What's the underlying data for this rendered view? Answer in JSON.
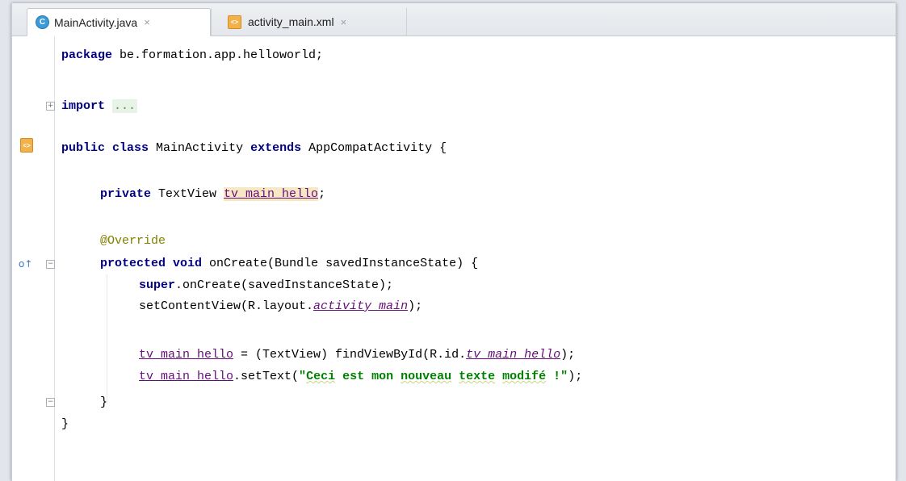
{
  "tabs": [
    {
      "label": "MainActivity.java",
      "icon": "java-class-icon",
      "active": true,
      "close": "×"
    },
    {
      "label": "activity_main.xml",
      "icon": "xml-layout-icon",
      "active": false,
      "close": "×"
    }
  ],
  "code": {
    "package_kw": "package",
    "package_name": " be.formation.app.helloworld;",
    "import_kw": "import",
    "import_fold": "...",
    "l3_public": "public",
    "l3_class": "class",
    "l3_name": " MainActivity ",
    "l3_extends": "extends",
    "l3_rest": " AppCompatActivity {",
    "l4_private": "private",
    "l4_type": " TextView ",
    "l4_field": "tv_main_hello",
    "l4_end": ";",
    "annotation": "@Override",
    "l6_protected": "protected",
    "l6_void": "void",
    "l6_rest": " onCreate(Bundle savedInstanceState) {",
    "l7_super": "super",
    "l7_rest": ".onCreate(savedInstanceState);",
    "l8_start": "setContentView(R.layout.",
    "l8_field": "activity_main",
    "l8_end": ");",
    "l9_field": "tv_main_hello",
    "l9_mid": " = (TextView) findViewById(R.id.",
    "l9_field2": "tv_main_hello",
    "l9_end": ");",
    "l10_field": "tv_main_hello",
    "l10_mid": ".setText(",
    "l10_str_a": "\"",
    "l10_str_w1": "Ceci",
    "l10_str_b": " est mon ",
    "l10_str_w2": "nouveau",
    "l10_str_c": " ",
    "l10_str_w3": "texte",
    "l10_str_d": " ",
    "l10_str_w4": "modifé",
    "l10_str_e": " !\"",
    "l10_end": ");",
    "close_method": "}",
    "close_class": "}"
  },
  "gutter": {
    "xml_marker_label": "<>",
    "override_marker": "o↑",
    "fold_plus": "+",
    "fold_minus": "−"
  },
  "colors": {
    "keyword": "#000080",
    "string": "#008000",
    "field": "#660e7a",
    "annotation": "#808000"
  }
}
